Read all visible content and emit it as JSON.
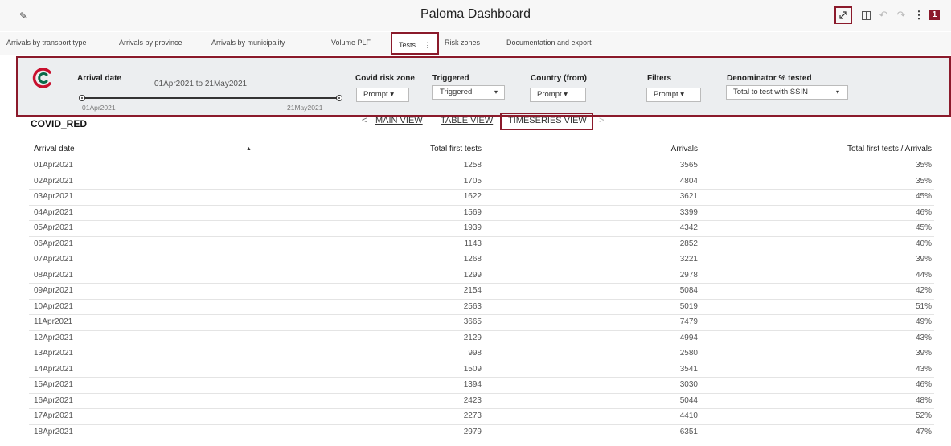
{
  "header": {
    "title": "Paloma Dashboard",
    "badge": "1",
    "icons": [
      "edit-icon",
      "maximize-icon",
      "panel-icon",
      "undo-icon",
      "redo-icon",
      "more-icon"
    ]
  },
  "tabs": [
    {
      "label": "Arrivals by transport type"
    },
    {
      "label": "Arrivals by province"
    },
    {
      "label": "Arrivals by municipality"
    },
    {
      "label": "Volume PLF"
    },
    {
      "label": "Tests",
      "active": true,
      "menu": "⋮"
    },
    {
      "label": "Risk zones"
    },
    {
      "label": "Documentation and export"
    }
  ],
  "filters": {
    "arrival_date_label": "Arrival date",
    "arrival_date_range": "01Apr2021 to 21May2021",
    "slider_min": "01Apr2021",
    "slider_max": "21May2021",
    "covid_risk_label": "Covid risk zone",
    "covid_risk_value": "Prompt ▾",
    "triggered_label": "Triggered",
    "triggered_value": "Triggered",
    "country_label": "Country (from)",
    "country_value": "Prompt ▾",
    "filters_label": "Filters",
    "filters_value": "Prompt ▾",
    "denominator_label": "Denominator % tested",
    "denominator_value": "Total to test with SSIN"
  },
  "views": {
    "section_title": "COVID_RED",
    "prev": "<",
    "next": ">",
    "main_view": "MAIN VIEW",
    "table_view": "TABLE VIEW",
    "timeseries_view": "TIMESERIES VIEW"
  },
  "table": {
    "headers": [
      "Arrival date",
      "Total first tests",
      "Arrivals",
      "Total first tests / Arrivals"
    ],
    "sort_indicator": "▲",
    "rows": [
      [
        "01Apr2021",
        "1258",
        "3565",
        "35%"
      ],
      [
        "02Apr2021",
        "1705",
        "4804",
        "35%"
      ],
      [
        "03Apr2021",
        "1622",
        "3621",
        "45%"
      ],
      [
        "04Apr2021",
        "1569",
        "3399",
        "46%"
      ],
      [
        "05Apr2021",
        "1939",
        "4342",
        "45%"
      ],
      [
        "06Apr2021",
        "1143",
        "2852",
        "40%"
      ],
      [
        "07Apr2021",
        "1268",
        "3221",
        "39%"
      ],
      [
        "08Apr2021",
        "1299",
        "2978",
        "44%"
      ],
      [
        "09Apr2021",
        "2154",
        "5084",
        "42%"
      ],
      [
        "10Apr2021",
        "2563",
        "5019",
        "51%"
      ],
      [
        "11Apr2021",
        "3665",
        "7479",
        "49%"
      ],
      [
        "12Apr2021",
        "2129",
        "4994",
        "43%"
      ],
      [
        "13Apr2021",
        "998",
        "2580",
        "39%"
      ],
      [
        "14Apr2021",
        "1509",
        "3541",
        "43%"
      ],
      [
        "15Apr2021",
        "1394",
        "3030",
        "46%"
      ],
      [
        "16Apr2021",
        "2423",
        "5044",
        "48%"
      ],
      [
        "17Apr2021",
        "2273",
        "4410",
        "52%"
      ],
      [
        "18Apr2021",
        "2979",
        "6351",
        "47%"
      ]
    ]
  },
  "colors": {
    "accent": "#8b1a2b",
    "logo": "#c8102e",
    "logo_green": "#0a6b4a"
  }
}
